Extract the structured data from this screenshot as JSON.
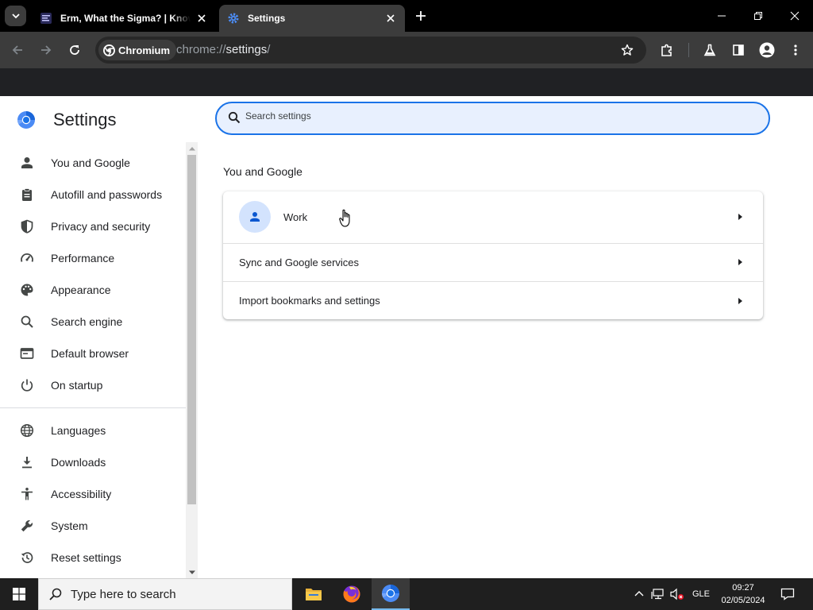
{
  "browser": {
    "tabs": [
      {
        "title": "Erm, What the Sigma? | Know Your Meme",
        "active": false,
        "icon": "kym-favicon"
      },
      {
        "title": "Settings",
        "active": true,
        "icon": "settings-gear-icon"
      }
    ],
    "omnibox": {
      "chip_label": "Chromium",
      "url_scheme": "chrome://",
      "url_host": "settings",
      "url_path": "/"
    }
  },
  "settings": {
    "page_title": "Settings",
    "search_placeholder": "Search settings",
    "nav": [
      {
        "label": "You and Google",
        "icon": "person-icon"
      },
      {
        "label": "Autofill and passwords",
        "icon": "clipboard-icon"
      },
      {
        "label": "Privacy and security",
        "icon": "shield-icon"
      },
      {
        "label": "Performance",
        "icon": "speedometer-icon"
      },
      {
        "label": "Appearance",
        "icon": "palette-icon"
      },
      {
        "label": "Search engine",
        "icon": "search-icon"
      },
      {
        "label": "Default browser",
        "icon": "browser-window-icon"
      },
      {
        "label": "On startup",
        "icon": "power-icon"
      },
      {
        "label": "Languages",
        "icon": "globe-icon"
      },
      {
        "label": "Downloads",
        "icon": "download-icon"
      },
      {
        "label": "Accessibility",
        "icon": "accessibility-icon"
      },
      {
        "label": "System",
        "icon": "wrench-icon"
      },
      {
        "label": "Reset settings",
        "icon": "history-icon"
      }
    ],
    "section_title": "You and Google",
    "rows": [
      {
        "label": "Work"
      },
      {
        "label": "Sync and Google services"
      },
      {
        "label": "Import bookmarks and settings"
      }
    ]
  },
  "taskbar": {
    "search_placeholder": "Type here to search",
    "language": "GLE",
    "time": "09:27",
    "date": "02/05/2024"
  },
  "colors": {
    "accent": "#1a73e8",
    "search_bg": "#e8f0fe",
    "avatar_bg": "#d3e3fd",
    "chrome_dark": "#3c3c3c"
  }
}
